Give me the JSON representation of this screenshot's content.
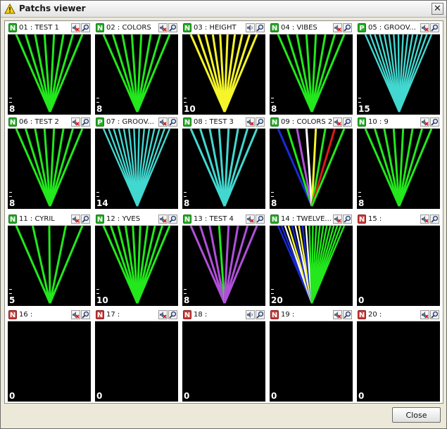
{
  "window": {
    "title": "Patchs viewer",
    "close_glyph": "✕",
    "title_icon": "warning-triangle-icon"
  },
  "colors": {
    "green": "#22e81c",
    "yellow": "#f5f52a",
    "cyan": "#42d8d0",
    "violet": "#b050d8",
    "blue": "#1a2ad8",
    "red": "#e01818",
    "white": "#ffffff"
  },
  "tiles": [
    {
      "badge": "N",
      "label": "01 : TEST 1",
      "count": "8",
      "beams": [
        "green",
        "green",
        "green",
        "green",
        "green",
        "green",
        "green",
        "green"
      ],
      "dashes": 2,
      "sound": "muted"
    },
    {
      "badge": "N",
      "label": "02 : COLORS",
      "count": "8",
      "beams": [
        "green",
        "green",
        "green",
        "green",
        "green",
        "green",
        "green",
        "green"
      ],
      "dashes": 2,
      "sound": "muted"
    },
    {
      "badge": "N",
      "label": "03 : HEIGHT",
      "count": "10",
      "beams": [
        "yellow",
        "yellow",
        "yellow",
        "yellow",
        "yellow",
        "yellow",
        "yellow",
        "yellow",
        "yellow",
        "yellow"
      ],
      "dashes": 2,
      "sound": "on"
    },
    {
      "badge": "N",
      "label": "04 : VIBES",
      "count": "8",
      "beams": [
        "green",
        "green",
        "green",
        "green",
        "green",
        "green",
        "green",
        "green"
      ],
      "dashes": 2,
      "sound": "muted"
    },
    {
      "badge": "P",
      "label": "05 : GROOV...",
      "count": "15",
      "beams": [
        "cyan",
        "cyan",
        "cyan",
        "cyan",
        "cyan",
        "cyan",
        "cyan",
        "cyan",
        "cyan",
        "cyan",
        "cyan",
        "cyan",
        "cyan",
        "cyan",
        "cyan"
      ],
      "dashes": 2,
      "sound": "muted"
    },
    {
      "badge": "N",
      "label": "06 : TEST 2",
      "count": "8",
      "beams": [
        "green",
        "green",
        "green",
        "green",
        "green",
        "green",
        "green",
        "green"
      ],
      "dashes": 2,
      "sound": "muted"
    },
    {
      "badge": "P",
      "label": "07 : GROOV...",
      "count": "14",
      "beams": [
        "cyan",
        "cyan",
        "cyan",
        "cyan",
        "cyan",
        "cyan",
        "cyan",
        "cyan",
        "cyan",
        "cyan",
        "cyan",
        "cyan",
        "cyan",
        "cyan"
      ],
      "dashes": 2,
      "sound": "muted"
    },
    {
      "badge": "N",
      "label": "08 : TEST 3",
      "count": "8",
      "beams": [
        "cyan",
        "cyan",
        "cyan",
        "cyan",
        "cyan",
        "cyan",
        "cyan",
        "cyan"
      ],
      "dashes": 2,
      "sound": "muted"
    },
    {
      "badge": "N",
      "label": "09 : COLORS 2",
      "count": "8",
      "beams": [
        "blue",
        "green",
        "violet",
        "white",
        "yellow",
        "green",
        "red",
        "green"
      ],
      "dashes": 2,
      "sound": "muted"
    },
    {
      "badge": "N",
      "label": "10 : 9",
      "count": "8",
      "beams": [
        "green",
        "green",
        "green",
        "green",
        "green",
        "green",
        "green",
        "green"
      ],
      "dashes": 2,
      "sound": "muted"
    },
    {
      "badge": "N",
      "label": "11 : CYRIL",
      "count": "5",
      "beams": [
        "green",
        "green",
        "green",
        "green",
        "green"
      ],
      "dashes": 2,
      "sound": "muted"
    },
    {
      "badge": "N",
      "label": "12 : YVES",
      "count": "10",
      "beams": [
        "green",
        "green",
        "green",
        "green",
        "green",
        "green",
        "green",
        "green",
        "green",
        "green"
      ],
      "dashes": 2,
      "sound": "muted"
    },
    {
      "badge": "N",
      "label": "13 : TEST 4",
      "count": "8",
      "beams": [
        "violet",
        "violet",
        "violet",
        "green",
        "violet",
        "violet",
        "violet",
        "violet"
      ],
      "dashes": 2,
      "sound": "muted"
    },
    {
      "badge": "N",
      "label": "14 : TWELVE...",
      "count": "20",
      "beams": [
        "blue",
        "blue",
        "white",
        "yellow",
        "blue",
        "white",
        "yellow",
        "blue",
        "white",
        "green",
        "green",
        "green",
        "green",
        "green",
        "green",
        "green",
        "green",
        "green",
        "green",
        "green"
      ],
      "dashes": 2,
      "sound": "muted"
    },
    {
      "badge": "R",
      "label": "15 :",
      "count": "0",
      "beams": [],
      "dashes": 0,
      "sound": "muted"
    },
    {
      "badge": "R",
      "label": "16 :",
      "count": "0",
      "beams": [],
      "dashes": 0,
      "sound": "muted"
    },
    {
      "badge": "R",
      "label": "17 :",
      "count": "0",
      "beams": [],
      "dashes": 0,
      "sound": "muted"
    },
    {
      "badge": "R",
      "label": "18 :",
      "count": "0",
      "beams": [],
      "dashes": 0,
      "sound": "on"
    },
    {
      "badge": "R",
      "label": "19 :",
      "count": "0",
      "beams": [],
      "dashes": 0,
      "sound": "muted"
    },
    {
      "badge": "R",
      "label": "20 :",
      "count": "0",
      "beams": [],
      "dashes": 0,
      "sound": "muted"
    }
  ],
  "footer": {
    "close_label": "Close"
  }
}
